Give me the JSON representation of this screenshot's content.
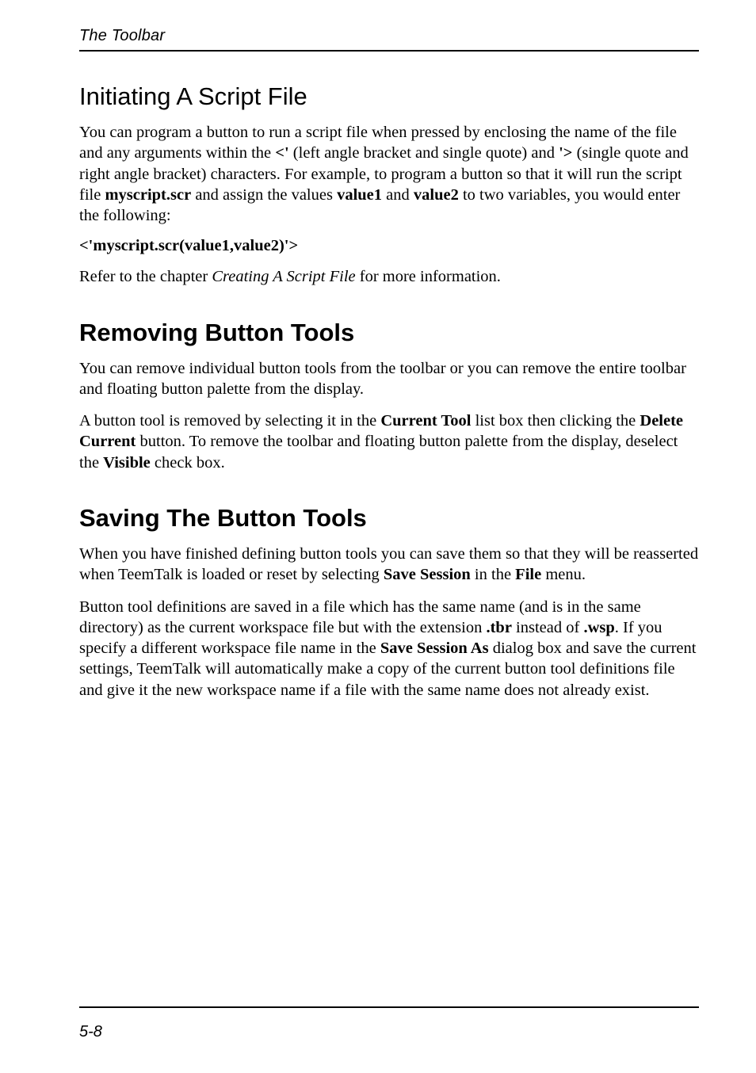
{
  "header": {
    "running_title": "The Toolbar"
  },
  "sections": {
    "s1": {
      "title": "Initiating A Script File",
      "p1_a": "You can program a button to run a script file when pressed by enclosing the name of the file and any arguments within the ",
      "p1_b": "<'",
      "p1_c": " (left angle bracket and single quote) and ",
      "p1_d": "'>",
      "p1_e": " (single quote and right angle bracket) characters. For example, to program a button so that it will run the script file ",
      "p1_f": "myscript.scr",
      "p1_g": " and assign the values ",
      "p1_h": "value1",
      "p1_i": " and ",
      "p1_j": "value2",
      "p1_k": " to two variables, you would enter the following:",
      "code": "<'myscript.scr(value1,value2)'>",
      "p2_a": "Refer to the chapter ",
      "p2_b": "Creating A Script File",
      "p2_c": " for more information."
    },
    "s2": {
      "title": "Removing Button Tools",
      "p1": "You can remove individual button tools from the toolbar or you can remove the entire toolbar and floating button palette from the display.",
      "p2_a": "A button tool is removed by selecting it in the ",
      "p2_b": "Current Tool",
      "p2_c": " list box then clicking the ",
      "p2_d": "Delete Current",
      "p2_e": " button. To remove the toolbar and floating button palette from the display, deselect the ",
      "p2_f": "Visible",
      "p2_g": " check box."
    },
    "s3": {
      "title": "Saving The Button Tools",
      "p1_a": "When you have finished defining button tools you can save them so that they will be reasserted when TeemTalk is loaded or reset by selecting ",
      "p1_b": "Save Session",
      "p1_c": " in the ",
      "p1_d": "File",
      "p1_e": " menu.",
      "p2_a": "Button tool definitions are saved in a file which has the same name (and is in the same directory) as the current workspace file but with the extension ",
      "p2_b": ".tbr",
      "p2_c": " instead of ",
      "p2_d": ".wsp",
      "p2_e": ". If you specify a different workspace file name in the ",
      "p2_f": "Save Session As",
      "p2_g": " dialog box and save the current settings, TeemTalk will automatically make a copy of the current button tool definitions file and give it the new workspace name if a file with the same name does not already exist."
    }
  },
  "footer": {
    "page_number": "5-8"
  }
}
